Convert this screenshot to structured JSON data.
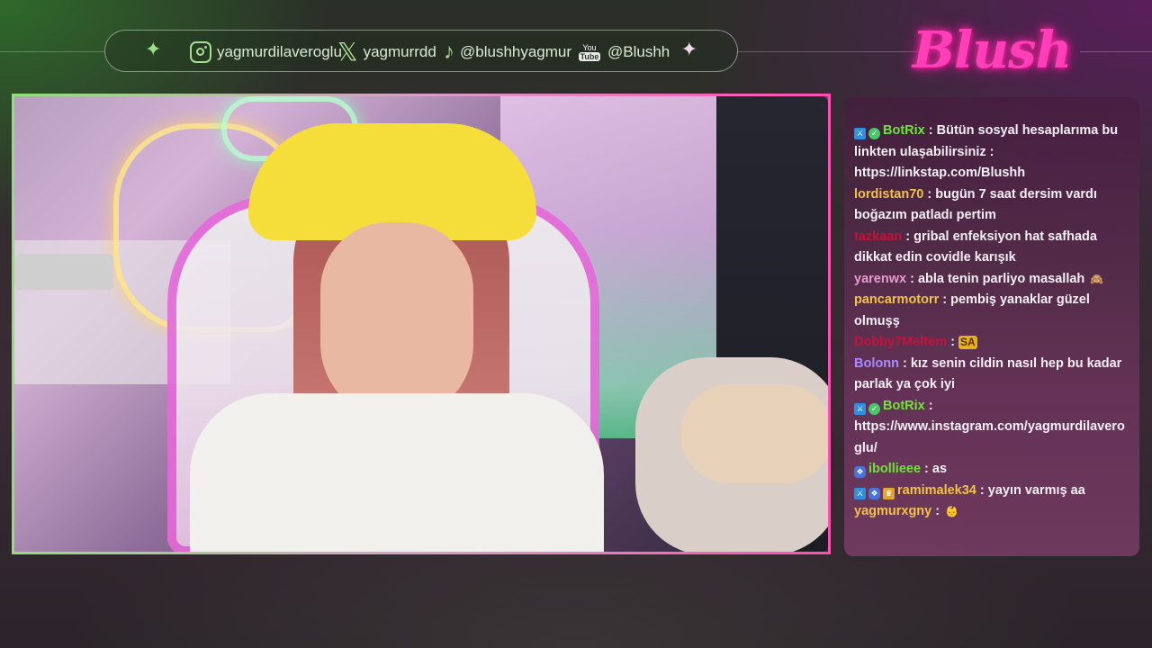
{
  "colors": {
    "accent_green": "#a6e08f",
    "accent_pink": "#ff3fb8",
    "chat_bg": "#7a3870"
  },
  "social_bar": {
    "instagram": "yagmurdilaveroglu",
    "twitter": "yagmurrdd",
    "tiktok": "@blushhyagmur",
    "youtube": "@Blushh",
    "youtube_icon_top": "You",
    "youtube_icon_bottom": "Tube"
  },
  "logo": {
    "text": "Blush"
  },
  "chat": {
    "messages": [
      {
        "user": "BotRix",
        "user_color": "#6fe23c",
        "badges": [
          "mod",
          "verified"
        ],
        "text": "Bütün sosyal hesaplarıma bu linkten ulaşabilirsiniz : https://linkstap.com/Blushh"
      },
      {
        "user": "lordistan70",
        "user_color": "#f1c14a",
        "badges": [],
        "text": "bugün 7 saat dersim vardı boğazım patladı pertim"
      },
      {
        "user": "tazkaan",
        "user_color": "#c5123a",
        "badges": [],
        "text": "gribal enfeksiyon hat safhada dikkat edin covidle karışık"
      },
      {
        "user": "yarenwx",
        "user_color": "#e89ad2",
        "badges": [],
        "text": "abla tenin parliyo masallah",
        "emote": "🙈"
      },
      {
        "user": "pancarmotorr",
        "user_color": "#f1c14a",
        "badges": [],
        "text": "pembiş yanaklar güzel olmuşş"
      },
      {
        "user": "Dobby7Meltem",
        "user_color": "#c5123a",
        "badges": [],
        "text": "",
        "emote": "SA"
      },
      {
        "user": "Bolonn",
        "user_color": "#a88bff",
        "badges": [],
        "text": "kız senin cildin nasıl hep bu kadar parlak ya çok iyi"
      },
      {
        "user": "BotRix",
        "user_color": "#6fe23c",
        "badges": [
          "mod",
          "verified"
        ],
        "text": "https://www.instagram.com/yagmurdilaveroglu/"
      },
      {
        "user": "ibollieee",
        "user_color": "#6fe23c",
        "badges": [
          "sub"
        ],
        "text": "as"
      },
      {
        "user": "ramimalek34",
        "user_color": "#f1c14a",
        "badges": [
          "mod",
          "sub",
          "vip"
        ],
        "text": "yayın varmış aa"
      },
      {
        "user": "yagmurxgny",
        "user_color": "#f1c14a",
        "badges": [],
        "text": "",
        "emote": "👶"
      }
    ]
  }
}
